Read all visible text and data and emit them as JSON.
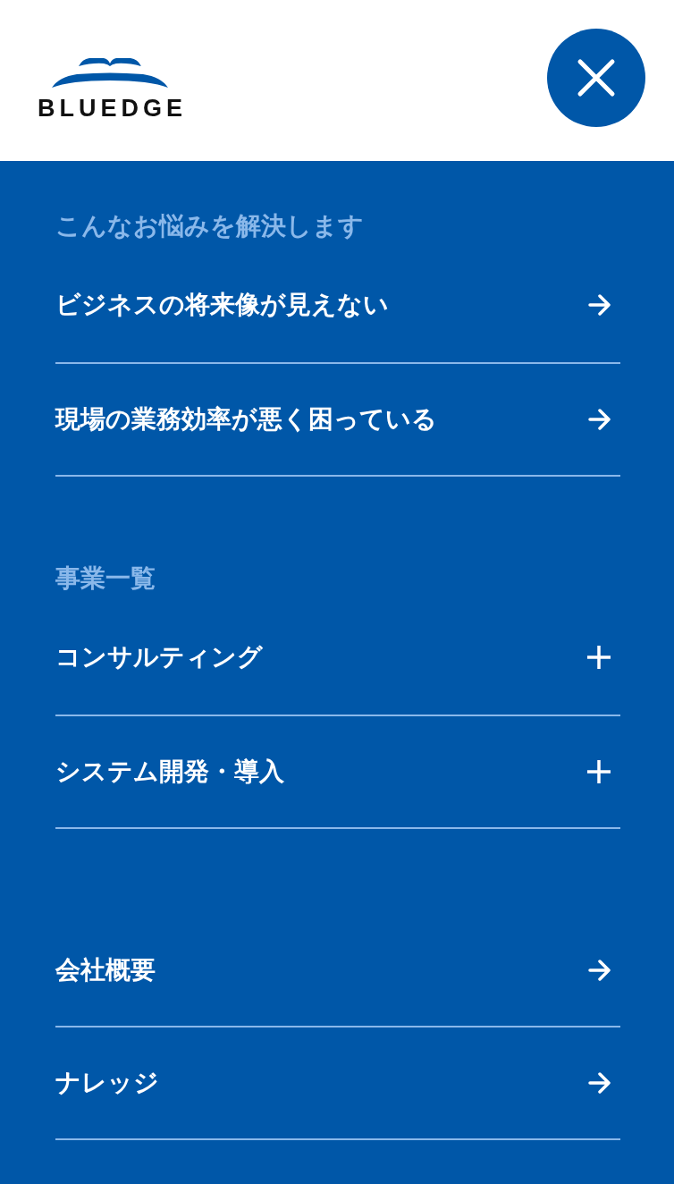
{
  "header": {
    "logo_text": "BLUEDGE"
  },
  "sections": [
    {
      "heading": "こんなお悩みを解決します",
      "items": [
        {
          "label": "ビジネスの将来像が見えない",
          "kind": "link"
        },
        {
          "label": "現場の業務効率が悪く困っている",
          "kind": "link"
        }
      ]
    },
    {
      "heading": "事業一覧",
      "items": [
        {
          "label": "コンサルティング",
          "kind": "expand"
        },
        {
          "label": "システム開発・導入",
          "kind": "expand"
        }
      ]
    },
    {
      "items": [
        {
          "label": "会社概要",
          "kind": "link"
        },
        {
          "label": "ナレッジ",
          "kind": "link"
        }
      ]
    }
  ]
}
